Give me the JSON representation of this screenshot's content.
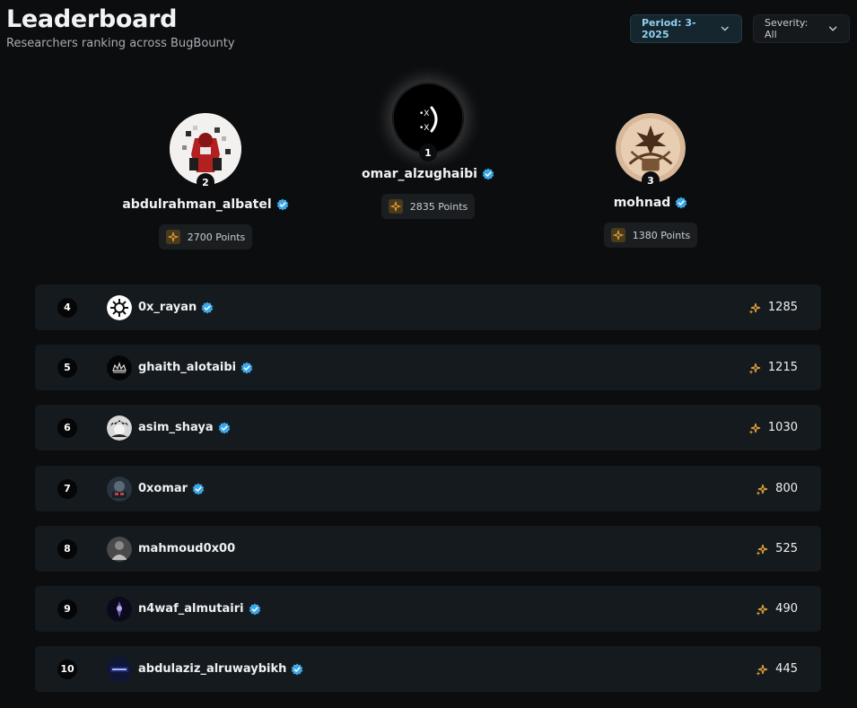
{
  "header": {
    "title": "Leaderboard",
    "subtitle": "Researchers ranking across BugBounty"
  },
  "filters": {
    "period_label": "Period: 3-2025",
    "severity_label": "Severity: All"
  },
  "podium": [
    {
      "rank": "1",
      "name": "omar_alzughaibi",
      "points": "2835 Points"
    },
    {
      "rank": "2",
      "name": "abdulrahman_albatel",
      "points": "2700 Points"
    },
    {
      "rank": "3",
      "name": "mohnad",
      "points": "1380 Points"
    }
  ],
  "rows": [
    {
      "rank": "4",
      "name": "0x_rayan",
      "points": "1285",
      "verified": true
    },
    {
      "rank": "5",
      "name": "ghaith_alotaibi",
      "points": "1215",
      "verified": true
    },
    {
      "rank": "6",
      "name": "asim_shaya",
      "points": "1030",
      "verified": true
    },
    {
      "rank": "7",
      "name": "0xomar",
      "points": "800",
      "verified": true
    },
    {
      "rank": "8",
      "name": "mahmoud0x00",
      "points": "525",
      "verified": false
    },
    {
      "rank": "9",
      "name": "n4waf_almutairi",
      "points": "490",
      "verified": true
    },
    {
      "rank": "10",
      "name": "abdulaziz_alruwaybikh",
      "points": "445",
      "verified": true
    }
  ],
  "colors": {
    "background": "#0b0d0f",
    "row": "#151a1e",
    "verified": "#3aa7e6",
    "sparkle": "#e0a13a"
  }
}
